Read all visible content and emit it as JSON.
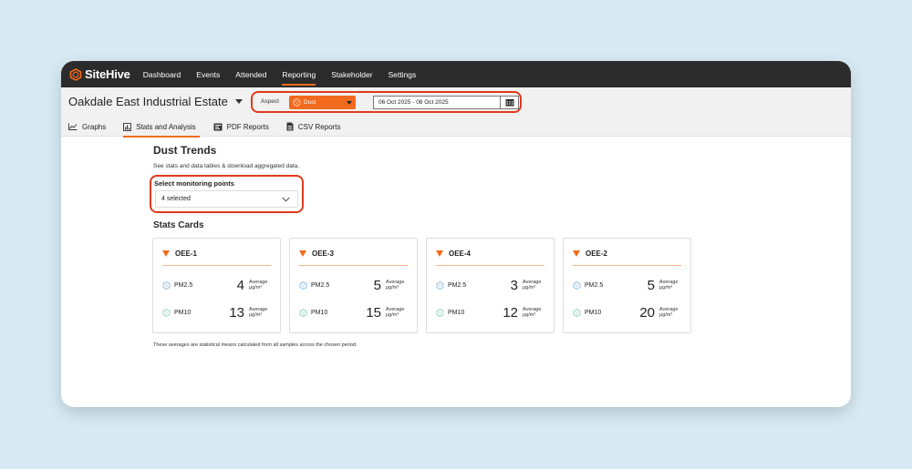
{
  "brand": {
    "name": "SiteHive",
    "accent": "#f26a1d",
    "alert_outline": "#e23a1c"
  },
  "nav": {
    "items": [
      {
        "label": "Dashboard",
        "active": false
      },
      {
        "label": "Events",
        "active": false
      },
      {
        "label": "Attended",
        "active": false
      },
      {
        "label": "Reporting",
        "active": true
      },
      {
        "label": "Stakeholder",
        "active": false
      },
      {
        "label": "Settings",
        "active": false
      }
    ]
  },
  "site": {
    "name": "Oakdale East Industrial Estate",
    "icon": "chevron-down-icon"
  },
  "filters": {
    "aspect_label": "Aspect",
    "aspect_value": "Dust",
    "aspect_icon": "dust-icon",
    "date_range": "06 Oct 2025 - 08 Oct 2025",
    "calendar_icon": "calendar-icon"
  },
  "tabs": [
    {
      "label": "Graphs",
      "icon": "line-chart-icon",
      "active": false
    },
    {
      "label": "Stats and Analysis",
      "icon": "bar-chart-icon",
      "active": true
    },
    {
      "label": "PDF Reports",
      "icon": "pdf-icon",
      "active": false
    },
    {
      "label": "CSV Reports",
      "icon": "csv-icon",
      "active": false
    }
  ],
  "main": {
    "title": "Dust Trends",
    "description": "See stats and data tables & download aggregated data.",
    "monitoring_points": {
      "label": "Select monitoring points",
      "value": "4 selected"
    },
    "stats_title": "Stats Cards",
    "footnote": "These averages are statistical means calculated from all samples across the chosen period."
  },
  "cards": [
    {
      "name": "OEE-1",
      "pm25": {
        "label": "PM2.5",
        "value": "4",
        "unit_line1": "Average",
        "unit_line2": "μg/m³"
      },
      "pm10": {
        "label": "PM10",
        "value": "13",
        "unit_line1": "Average",
        "unit_line2": "μg/m³"
      }
    },
    {
      "name": "OEE-3",
      "pm25": {
        "label": "PM2.5",
        "value": "5",
        "unit_line1": "Average",
        "unit_line2": "μg/m³"
      },
      "pm10": {
        "label": "PM10",
        "value": "15",
        "unit_line1": "Average",
        "unit_line2": "μg/m³"
      }
    },
    {
      "name": "OEE-4",
      "pm25": {
        "label": "PM2.5",
        "value": "3",
        "unit_line1": "Average",
        "unit_line2": "μg/m³"
      },
      "pm10": {
        "label": "PM10",
        "value": "12",
        "unit_line1": "Average",
        "unit_line2": "μg/m³"
      }
    },
    {
      "name": "OEE-2",
      "pm25": {
        "label": "PM2.5",
        "value": "5",
        "unit_line1": "Average",
        "unit_line2": "μg/m³"
      },
      "pm10": {
        "label": "PM10",
        "value": "20",
        "unit_line1": "Average",
        "unit_line2": "μg/m³"
      }
    }
  ]
}
